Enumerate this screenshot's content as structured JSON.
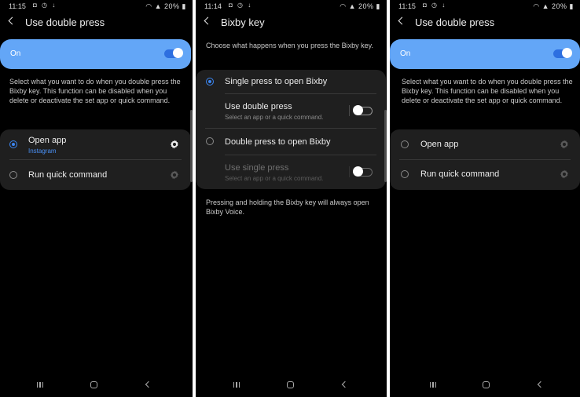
{
  "screens": [
    {
      "status": {
        "time": "11:15",
        "battery": "20%"
      },
      "title": "Use double press",
      "master": {
        "label": "On",
        "on": true
      },
      "description": "Select what you want to do when you double press the Bixby key. This function can be disabled when you delete or deactivate the set app or quick command.",
      "options": [
        {
          "label": "Open app",
          "sub": "Instagram",
          "selected": true
        },
        {
          "label": "Run quick command",
          "selected": false
        }
      ]
    },
    {
      "status": {
        "time": "11:14",
        "battery": "20%"
      },
      "title": "Bixby key",
      "description": "Choose what happens when you press the Bixby key.",
      "options": [
        {
          "label": "Single press to open Bixby",
          "selected": true
        },
        {
          "label": "Use double press",
          "sub": "Select an app or a quick command.",
          "toggle_on": false
        },
        {
          "label": "Double press to open Bixby",
          "selected": false
        },
        {
          "label": "Use single press",
          "sub": "Select an app or a quick command.",
          "toggle_on": false
        }
      ],
      "footer": "Pressing and holding the Bixby key will always open Bixby Voice."
    },
    {
      "status": {
        "time": "11:15",
        "battery": "20%"
      },
      "title": "Use double press",
      "master": {
        "label": "On",
        "on": true
      },
      "description": "Select what you want to do when you double press the Bixby key. This function can be disabled when you delete or deactivate the set app or quick command.",
      "options": [
        {
          "label": "Open app",
          "selected": false
        },
        {
          "label": "Run quick command",
          "selected": false
        }
      ]
    }
  ],
  "icons": {
    "back": "chevron-left-icon",
    "settings": "gear-icon",
    "nav_recent": "recent-apps-icon",
    "nav_home": "home-icon",
    "nav_back": "back-icon"
  },
  "colors": {
    "accent": "#3b86f2",
    "master_bar": "#63a6f7",
    "card": "#1f1f1f",
    "background": "#000000"
  }
}
